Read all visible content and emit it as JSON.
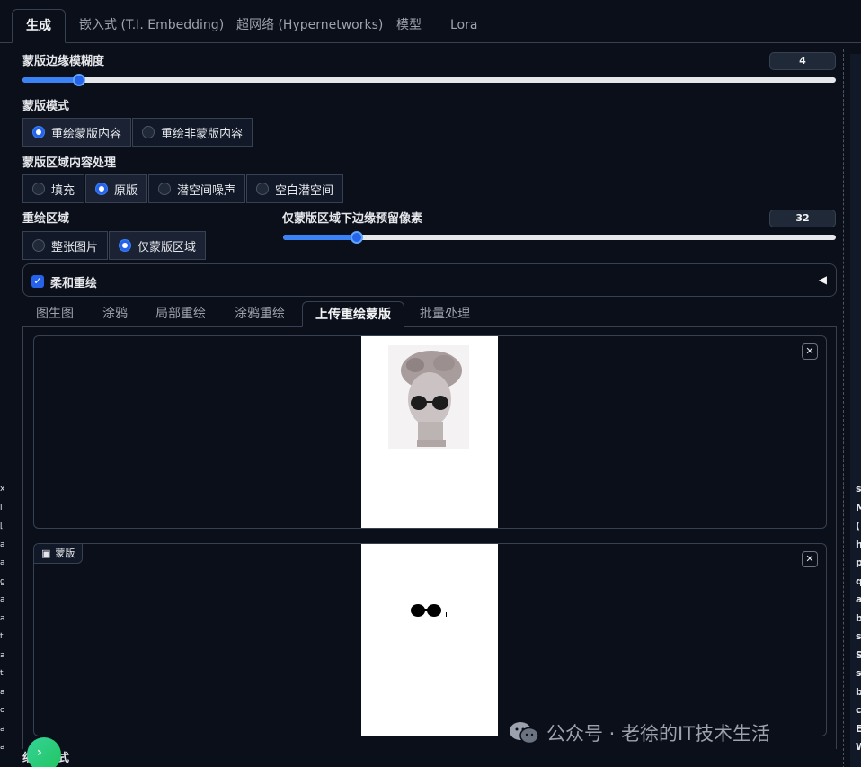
{
  "top_tabs": [
    "生成",
    "嵌入式 (T.I. Embedding)",
    "超网络 (Hypernetworks)",
    "模型",
    "Lora"
  ],
  "mask_blur": {
    "label": "蒙版边缘模糊度",
    "value": "4",
    "fraction": 0.07
  },
  "mask_mode": {
    "label": "蒙版模式",
    "options": [
      "重绘蒙版内容",
      "重绘非蒙版内容"
    ],
    "selected": "重绘蒙版内容"
  },
  "masked_content": {
    "label": "蒙版区域内容处理",
    "options": [
      "填充",
      "原版",
      "潜空间噪声",
      "空白潜空间"
    ],
    "selected": "原版"
  },
  "inpaint_area": {
    "label": "重绘区域",
    "options": [
      "整张图片",
      "仅蒙版区域"
    ],
    "selected": "仅蒙版区域"
  },
  "padding": {
    "label": "仅蒙版区域下边缘预留像素",
    "value": "32",
    "fraction": 0.13
  },
  "soft_inpaint": {
    "label": "柔和重绘",
    "checked": true,
    "collapse_icon": "triangle-left-icon"
  },
  "sub_tabs": [
    "图生图",
    "涂鸦",
    "局部重绘",
    "涂鸦重绘",
    "上传重绘蒙版",
    "批量处理"
  ],
  "image_panel": {
    "close_icon": "✕"
  },
  "mask_panel": {
    "label": "蒙版",
    "close_icon": "✕"
  },
  "bottom_label": "缩放模式",
  "watermark": "公众号 · 老徐的IT技术生活",
  "right_column_chars": [
    "s",
    "M",
    "(",
    "h",
    "p",
    "q",
    "a",
    "b",
    "s",
    "S",
    "s",
    "b",
    "c",
    "E",
    "W"
  ],
  "left_column_chars": [
    "x",
    "l",
    "[",
    "a",
    "a",
    "g",
    "a",
    "a",
    "t",
    "a",
    "t",
    "a",
    "o",
    "a",
    "a"
  ],
  "colors": {
    "accent": "#2563eb",
    "background": "#0b0f19",
    "border": "#374151"
  }
}
